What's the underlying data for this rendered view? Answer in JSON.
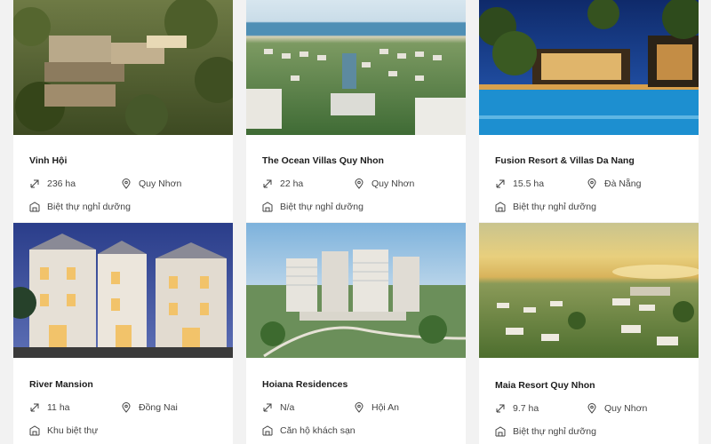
{
  "cards": [
    {
      "name": "Vinh Hội",
      "area": "236 ha",
      "location": "Quy Nhơn",
      "type": "Biệt thự nghỉ dưỡng",
      "image_desc": "hillside resort villas among trees"
    },
    {
      "name": "The Ocean Villas Quy Nhon",
      "area": "22 ha",
      "location": "Quy Nhơn",
      "type": "Biệt thự nghỉ dưỡng",
      "image_desc": "aerial view of beachfront villa complex"
    },
    {
      "name": "Fusion Resort & Villas Da Nang",
      "area": "15.5 ha",
      "location": "Đà Nẵng",
      "type": "Biệt thự nghỉ dưỡng",
      "image_desc": "pool villa at dusk with palm trees"
    },
    {
      "name": "River Mansion",
      "area": "11 ha",
      "location": "Đồng Nai",
      "type": "Khu biệt thự",
      "image_desc": "classical white mansions at night"
    },
    {
      "name": "Hoiana Residences",
      "area": "N/a",
      "location": "Hội An",
      "type": "Căn hộ khách sạn",
      "image_desc": "high-rise residences by the coast"
    },
    {
      "name": "Maia Resort Quy Nhon",
      "area": "9.7 ha",
      "location": "Quy Nhơn",
      "type": "Biệt thự nghỉ dưỡng",
      "image_desc": "beach resort villas at sunset"
    }
  ],
  "colors": {
    "page_bg": "#f2f2f2",
    "card_bg": "#ffffff",
    "title": "#1c1c1c",
    "meta_text": "#444444"
  },
  "icons": {
    "area": "diagonal-arrow-icon",
    "location": "map-pin-icon",
    "type": "building-icon"
  }
}
